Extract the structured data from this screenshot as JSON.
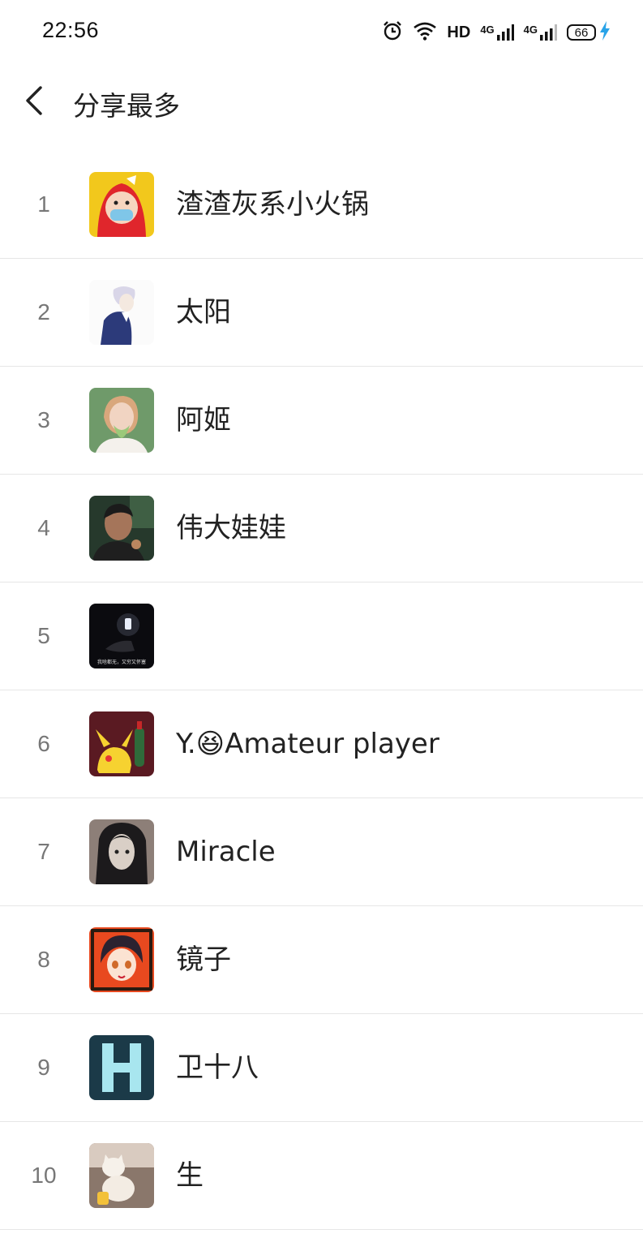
{
  "status_bar": {
    "time": "22:56",
    "net_label": "HD",
    "signal_1_label": "4G",
    "signal_2_label": "4G",
    "battery_level": "66",
    "icons": [
      "alarm-icon",
      "wifi-icon",
      "signal-icon",
      "signal-icon",
      "battery-icon",
      "charging-bolt-icon"
    ]
  },
  "header": {
    "title": "分享最多",
    "back_icon": "chevron-left-icon"
  },
  "ranking": [
    {
      "rank": "1",
      "name": "渣渣灰系小火锅",
      "avatar": "red-hooded-cartoon-avatar"
    },
    {
      "rank": "2",
      "name": " 太阳",
      "avatar": "anime-boy-avatar"
    },
    {
      "rank": "3",
      "name": "阿姬",
      "avatar": "girl-photo-avatar"
    },
    {
      "rank": "4",
      "name": "伟大娃娃",
      "avatar": "man-photo-avatar"
    },
    {
      "rank": "5",
      "name": "",
      "avatar": "dark-lamp-avatar",
      "avatar_caption": "我啥都无，又穷又怀塞"
    },
    {
      "rank": "6",
      "name": "Y.😆Amateur player",
      "avatar": "pikachu-avatar"
    },
    {
      "rank": "7",
      "name": "Miracle",
      "avatar": "anime-long-hair-avatar"
    },
    {
      "rank": "8",
      "name": "镜子",
      "avatar": "anime-girl-avatar"
    },
    {
      "rank": "9",
      "name": "卫十八",
      "avatar": "letter-h-avatar"
    },
    {
      "rank": "10",
      "name": "生",
      "avatar": "cat-photo-avatar"
    }
  ]
}
